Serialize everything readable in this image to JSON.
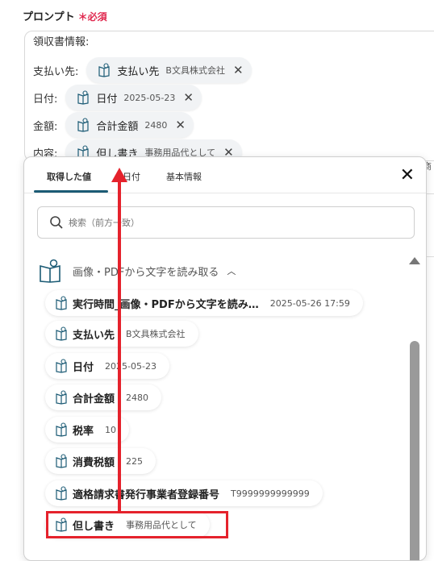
{
  "field": {
    "label": "プロンプト",
    "required_mark": "＊必須"
  },
  "editor": {
    "header": "領収書情報:",
    "lines": [
      {
        "label": "支払い先:",
        "chip_key": "支払い先",
        "chip_value": "B文具株式会社"
      },
      {
        "label": "日付:",
        "chip_key": "日付",
        "chip_value": "2025-05-23"
      },
      {
        "label": "金額:",
        "chip_key": "合計金額",
        "chip_value": "2480"
      },
      {
        "label": "内容:",
        "chip_key": "但し書き",
        "chip_value": "事務用品代として"
      }
    ],
    "overflow_text": "商"
  },
  "popup": {
    "tabs": [
      "取得した値",
      "日付",
      "基本情報"
    ],
    "active_tab": "取得した値",
    "search_placeholder": "検索（前方一致）",
    "section_title": "画像・PDFから文字を読み取る",
    "items": [
      {
        "key": "実行時間_画像・PDFから文字を読み…",
        "value": "2025-05-26 17:59"
      },
      {
        "key": "支払い先",
        "value": "B文具株式会社"
      },
      {
        "key": "日付",
        "value": "2025-05-23"
      },
      {
        "key": "合計金額",
        "value": "2480"
      },
      {
        "key": "税率",
        "value": "10"
      },
      {
        "key": "消費税額",
        "value": "225"
      },
      {
        "key": "適格請求書発行事業者登録番号",
        "value": "T9999999999999"
      },
      {
        "key": "但し書き",
        "value": "事務用品代として"
      }
    ]
  },
  "colors": {
    "accent": "#1c5b75",
    "annotation": "#e5222c",
    "required": "#e0294f"
  },
  "icons": {
    "item": "open-book-icon",
    "close": "close-icon",
    "search": "search-icon",
    "collapse": "chevron-up-icon"
  }
}
